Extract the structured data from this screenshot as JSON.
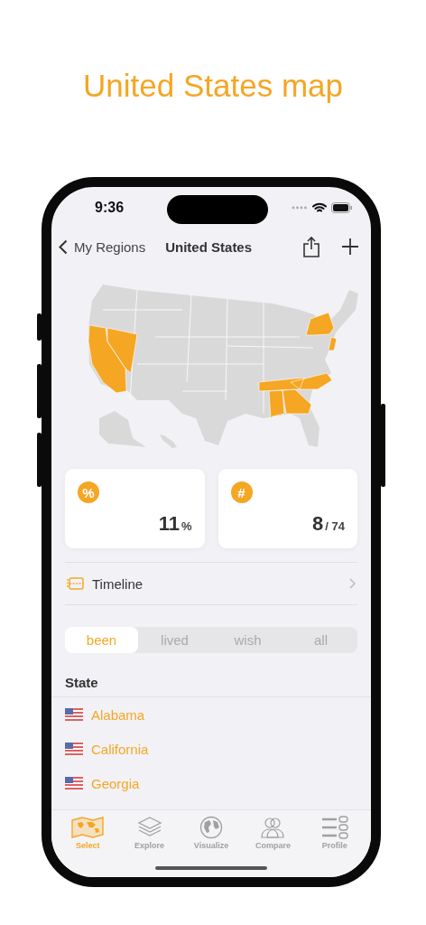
{
  "header": {
    "title": "United States map"
  },
  "status_bar": {
    "time": "9:36"
  },
  "nav": {
    "back": "My Regions",
    "title": "United States"
  },
  "stats": [
    {
      "icon": "%",
      "value": "11",
      "unit": "%"
    },
    {
      "icon": "#",
      "value": "8",
      "unit": "/ 74"
    }
  ],
  "timeline": {
    "label": "Timeline"
  },
  "segments": [
    {
      "label": "been",
      "selected": true
    },
    {
      "label": "lived",
      "selected": false
    },
    {
      "label": "wish",
      "selected": false
    },
    {
      "label": "all",
      "selected": false
    }
  ],
  "list": {
    "header": "State",
    "rows": [
      {
        "name": "Alabama"
      },
      {
        "name": "California"
      },
      {
        "name": "Georgia"
      }
    ]
  },
  "tab_bar": [
    {
      "label": "Select",
      "selected": true
    },
    {
      "label": "Explore",
      "selected": false
    },
    {
      "label": "Visualize",
      "selected": false
    },
    {
      "label": "Compare",
      "selected": false
    },
    {
      "label": "Profile",
      "selected": false
    }
  ]
}
